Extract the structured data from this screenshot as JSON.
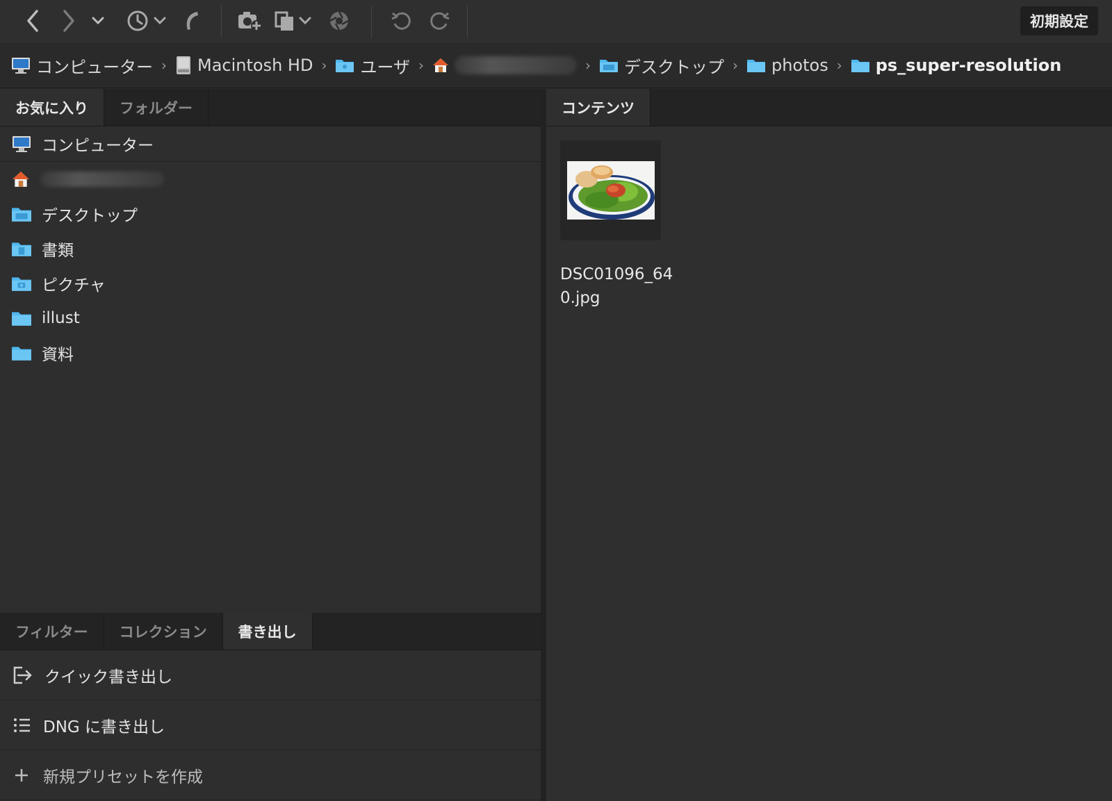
{
  "toolbar": {
    "preferences_label": "初期設定",
    "icons": [
      "back-icon",
      "forward-icon",
      "history-icon",
      "boomerang-icon",
      "camera-import-icon",
      "copy-icon",
      "aperture-icon",
      "rotate-left-icon",
      "rotate-right-icon"
    ]
  },
  "breadcrumb": {
    "items": [
      {
        "label": "コンピューター",
        "icon": "computer-icon"
      },
      {
        "label": "Macintosh HD",
        "icon": "drive-icon"
      },
      {
        "label": "ユーザ",
        "icon": "folder-icon"
      },
      {
        "label": "",
        "icon": "home-icon"
      },
      {
        "label": "デスクトップ",
        "icon": "folder-icon"
      },
      {
        "label": "photos",
        "icon": "folder-icon"
      },
      {
        "label": "ps_super-resolution",
        "icon": "folder-icon"
      }
    ]
  },
  "left_panel": {
    "tabs": [
      "お気に入り",
      "フォルダー"
    ],
    "favorites": [
      {
        "label": "コンピューター",
        "icon": "computer-icon"
      },
      {
        "label": "",
        "icon": "home-icon"
      },
      {
        "label": "デスクトップ",
        "icon": "folder-icon"
      },
      {
        "label": "書類",
        "icon": "documents-folder-icon"
      },
      {
        "label": "ピクチャ",
        "icon": "pictures-folder-icon"
      },
      {
        "label": "illust",
        "icon": "folder-icon"
      },
      {
        "label": "資料",
        "icon": "folder-icon"
      }
    ],
    "bottom_tabs": [
      "フィルター",
      "コレクション",
      "書き出し"
    ],
    "export_items": [
      {
        "label": "クイック書き出し",
        "icon": "quick-export-icon"
      },
      {
        "label": "DNG に書き出し",
        "icon": "list-icon"
      },
      {
        "label": "新規プリセットを作成",
        "icon": "plus-icon"
      }
    ]
  },
  "content": {
    "tab": "コンテンツ",
    "files": [
      {
        "name": "DSC01096_640.jpg"
      }
    ]
  },
  "colors": {
    "folder": "#4fb7ee",
    "background": "#2b2b2b",
    "tab_active": "#2f2f2f"
  }
}
